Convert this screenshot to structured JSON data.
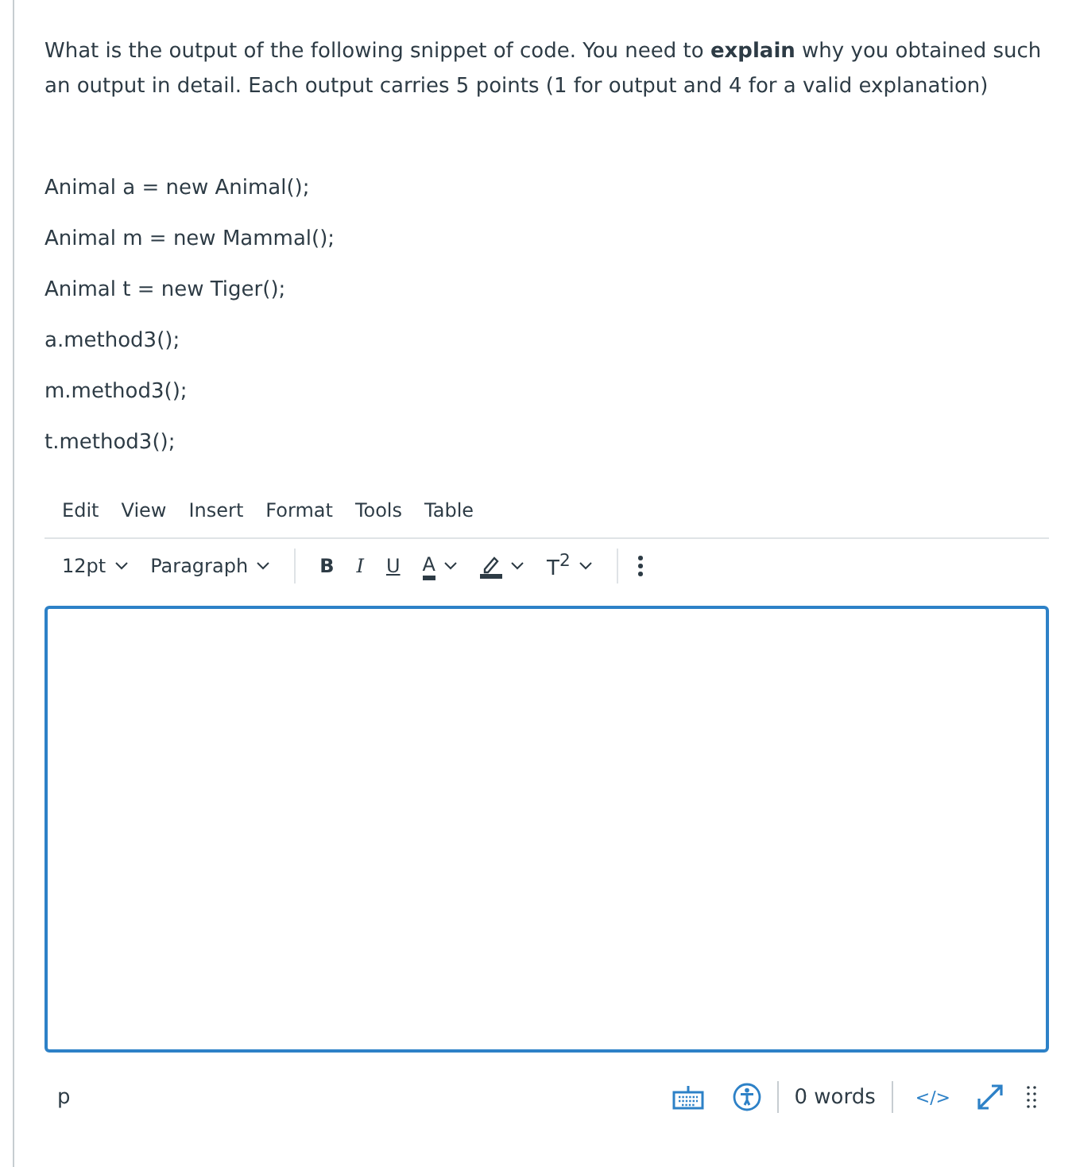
{
  "question": {
    "text": "What is the output of the following snippet of code. You need to **explain** why you obtained such an output in detail. Each output carries 5 points (1 for output and 4 for a valid explanation)"
  },
  "code_lines": [
    "Animal a = new Animal();",
    "Animal m = new Mammal();",
    "Animal t = new Tiger();",
    "a.method3();",
    "m.method3();",
    "t.method3();"
  ],
  "editor": {
    "menu": [
      "Edit",
      "View",
      "Insert",
      "Format",
      "Tools",
      "Table"
    ],
    "font_size": "12pt",
    "block_format": "Paragraph",
    "format_buttons": [
      {
        "kind": "bold",
        "label": "B"
      },
      {
        "kind": "italic",
        "label": "I"
      },
      {
        "kind": "underline",
        "label": "U"
      },
      {
        "kind": "text_color",
        "label": "A"
      },
      {
        "kind": "highlight"
      },
      {
        "kind": "superscript",
        "label": "T$^{2}$"
      }
    ],
    "status": {
      "path": "p",
      "word_count": "0 words",
      "html_toggle": "</>"
    }
  }
}
